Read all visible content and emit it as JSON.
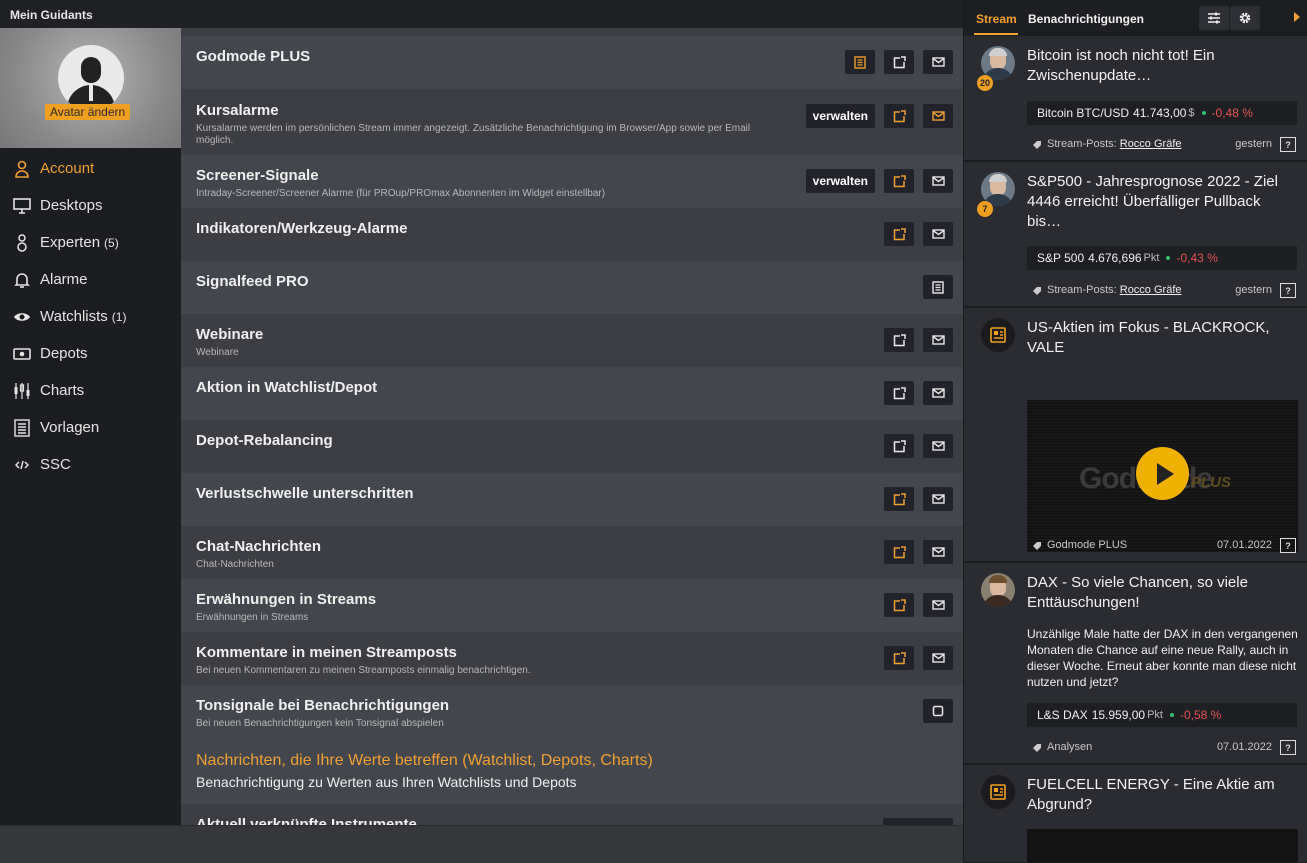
{
  "app": {
    "title": "Mein Guidants"
  },
  "sidebar": {
    "avatar_button": "Avatar ändern",
    "items": [
      {
        "label": "Account",
        "count": "",
        "icon": "person-icon",
        "active": true
      },
      {
        "label": "Desktops",
        "count": "",
        "icon": "monitor-icon",
        "active": false
      },
      {
        "label": "Experten",
        "count": "(5)",
        "icon": "experts-icon",
        "active": false
      },
      {
        "label": "Alarme",
        "count": "",
        "icon": "bell-icon",
        "active": false
      },
      {
        "label": "Watchlists",
        "count": "(1)",
        "icon": "eye-icon",
        "active": false
      },
      {
        "label": "Depots",
        "count": "",
        "icon": "money-icon",
        "active": false
      },
      {
        "label": "Charts",
        "count": "",
        "icon": "candlestick-icon",
        "active": false
      },
      {
        "label": "Vorlagen",
        "count": "",
        "icon": "template-icon",
        "active": false
      },
      {
        "label": "SSC",
        "count": "",
        "icon": "code-icon",
        "active": false
      }
    ]
  },
  "settings": {
    "rows": [
      {
        "name": "Godmode PLUS",
        "desc": "",
        "manage": "",
        "buttons": [
          "list-icon",
          "export-icon",
          "mail-icon"
        ],
        "active": [
          true,
          false,
          false
        ]
      },
      {
        "name": "Kursalarme",
        "desc": "Kursalarme werden im persönlichen Stream immer angezeigt. Zusätzliche Benachrichtigung im Browser/App sowie per Email möglich.",
        "manage": "verwalten",
        "buttons": [
          "export-icon",
          "mail-icon"
        ],
        "active": [
          true,
          true
        ]
      },
      {
        "name": "Screener-Signale",
        "desc": "Intraday-Screener/Screener Alarme (für PROup/PROmax Abonnenten im Widget einstellbar)",
        "manage": "verwalten",
        "buttons": [
          "export-icon",
          "mail-icon"
        ],
        "active": [
          true,
          false
        ]
      },
      {
        "name": "Indikatoren/Werkzeug-Alarme",
        "desc": "",
        "manage": "",
        "buttons": [
          "export-icon",
          "mail-icon"
        ],
        "active": [
          true,
          false
        ]
      },
      {
        "name": "Signalfeed PRO",
        "desc": "",
        "manage": "",
        "buttons": [
          "list-icon"
        ],
        "active": [
          false
        ]
      },
      {
        "name": "Webinare",
        "desc": "Webinare",
        "manage": "",
        "buttons": [
          "export-icon",
          "mail-icon"
        ],
        "active": [
          false,
          false
        ]
      },
      {
        "name": "Aktion in Watchlist/Depot",
        "desc": "",
        "manage": "",
        "buttons": [
          "export-icon",
          "mail-icon"
        ],
        "active": [
          false,
          false
        ]
      },
      {
        "name": "Depot-Rebalancing",
        "desc": "",
        "manage": "",
        "buttons": [
          "export-icon",
          "mail-icon"
        ],
        "active": [
          false,
          false
        ]
      },
      {
        "name": "Verlustschwelle unterschritten",
        "desc": "",
        "manage": "",
        "buttons": [
          "export-icon",
          "mail-icon"
        ],
        "active": [
          true,
          false
        ]
      },
      {
        "name": "Chat-Nachrichten",
        "desc": "Chat-Nachrichten",
        "manage": "",
        "buttons": [
          "export-icon",
          "mail-icon"
        ],
        "active": [
          true,
          false
        ]
      },
      {
        "name": "Erwähnungen in Streams",
        "desc": "Erwähnungen in Streams",
        "manage": "",
        "buttons": [
          "export-icon",
          "mail-icon"
        ],
        "active": [
          true,
          false
        ]
      },
      {
        "name": "Kommentare in meinen Streamposts",
        "desc": "Bei neuen Kommentaren zu meinen Streamposts einmalig benachrichtigen.",
        "manage": "",
        "buttons": [
          "export-icon",
          "mail-icon"
        ],
        "active": [
          true,
          false
        ]
      },
      {
        "name": "Tonsignale bei Benachrichtigungen",
        "desc": "Bei neuen Benachrichtigungen kein Tonsignal abspielen",
        "manage": "",
        "buttons": [
          "checkbox-icon"
        ],
        "active": [
          false
        ]
      }
    ],
    "section": {
      "title": "Nachrichten, die Ihre Werte betreffen (Watchlist, Depots, Charts)",
      "subtitle": "Benachrichtigung zu Werten aus Ihren Watchlists und Depots"
    },
    "partial_row": "Aktuell verknüpfte Instrumente"
  },
  "stream": {
    "tabs": [
      "Stream",
      "Benachrichtigungen"
    ],
    "cards": [
      {
        "title": "Bitcoin ist noch nicht tot! Ein Zwischenupdate…",
        "badge": "20",
        "ticker": {
          "name": "Bitcoin BTC/USD",
          "value": "41.743,00",
          "unit": "$",
          "change": "-0,48 %"
        },
        "tag": "Stream-Posts:",
        "author": "Rocco Gräfe",
        "date": "gestern"
      },
      {
        "title": "S&P500 - Jahresprognose 2022 - Ziel 4446 erreicht! Überfälliger Pullback bis…",
        "badge": "7",
        "ticker": {
          "name": "S&P 500",
          "value": "4.676,696",
          "unit": "Pkt",
          "change": "-0,43 %"
        },
        "tag": "Stream-Posts:",
        "author": "Rocco Gräfe",
        "date": "gestern"
      },
      {
        "title": "US-Aktien im Fokus - BLACKROCK, VALE",
        "video_logo": "Godmode",
        "video_logo_plus": "PLUS",
        "tag": "Godmode PLUS",
        "date": "07.01.2022"
      },
      {
        "title": "DAX - So viele Chancen, so viele Enttäuschungen!",
        "text": "Unzählige Male hatte der DAX in den vergangenen Monaten die Chance auf eine neue Rally, auch in dieser Woche. Erneut aber konnte man diese nicht nutzen und jetzt?",
        "ticker": {
          "name": "L&S DAX",
          "value": "15.959,00",
          "unit": "Pkt",
          "change": "-0,58 %"
        },
        "tag": "Analysen",
        "date": "07.01.2022"
      },
      {
        "title": "FUELCELL ENERGY - Eine Aktie am Abgrund?"
      }
    ]
  },
  "colors": {
    "accent": "#f0a030",
    "negative": "#e25454",
    "positive": "#2ec070"
  }
}
